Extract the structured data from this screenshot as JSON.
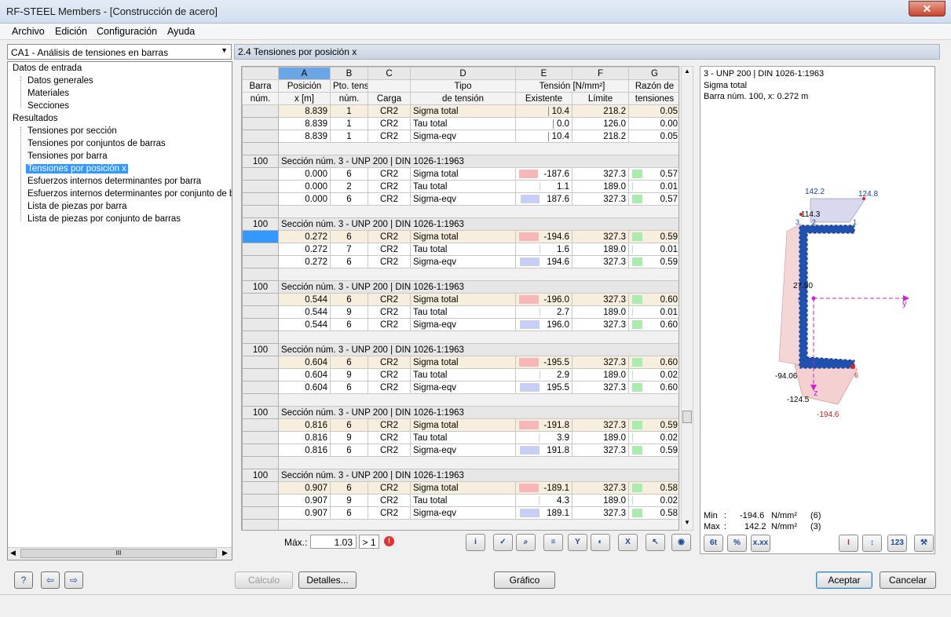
{
  "window": {
    "title": "RF-STEEL Members - [Construcción de acero]",
    "close_glyph": "✕"
  },
  "menu": [
    "Archivo",
    "Edición",
    "Configuración",
    "Ayuda"
  ],
  "case_select": {
    "value": "CA1 - Análisis de tensiones en barras"
  },
  "tree": {
    "group1": "Datos de entrada",
    "input_items": [
      "Datos generales",
      "Materiales",
      "Secciones"
    ],
    "group2": "Resultados",
    "result_items": [
      "Tensiones por sección",
      "Tensiones por conjuntos de barras",
      "Tensiones por barra",
      "Tensiones por posición x",
      "Esfuerzos internos determinantes por barra",
      "Esfuerzos internos determinantes por conjunto de barra",
      "Lista de piezas por barra",
      "Lista de piezas por conjunto de barras"
    ],
    "selected": "Tensiones por posición x",
    "scroll_thumb": "III"
  },
  "panel_title": "2.4 Tensiones por posición x",
  "table": {
    "col_letters": [
      "A",
      "B",
      "C",
      "D",
      "E",
      "F",
      "G"
    ],
    "header1": [
      "Barra",
      "Posición",
      "Pto. tens.",
      "",
      "Tipo",
      "Tensión [N/mm²]",
      "Razón de"
    ],
    "header2": [
      "núm.",
      "x [m]",
      "núm.",
      "Carga",
      "de tensión",
      "Existente",
      "Límite",
      "tensiones"
    ],
    "top_rows": [
      {
        "x": "8.839",
        "pt": "1",
        "load": "CR2",
        "type": "Sigma total",
        "exist": "10.4",
        "limit": "218.2",
        "ratio": "0.05",
        "hl": true
      },
      {
        "x": "8.839",
        "pt": "1",
        "load": "CR2",
        "type": "Tau total",
        "exist": "0.0",
        "limit": "126.0",
        "ratio": "0.00",
        "hl": false
      },
      {
        "x": "8.839",
        "pt": "1",
        "load": "CR2",
        "type": "Sigma-eqv",
        "exist": "10.4",
        "limit": "218.2",
        "ratio": "0.05",
        "hl": false
      }
    ],
    "section_label": "Sección núm.  3 - UNP 200 | DIN 1026-1:1963",
    "groups": [
      {
        "member": "100",
        "rows": [
          {
            "x": "0.000",
            "pt": "6",
            "load": "CR2",
            "type": "Sigma total",
            "exist": "-187.6",
            "limit": "327.3",
            "ratio": "0.57"
          },
          {
            "x": "0.000",
            "pt": "2",
            "load": "CR2",
            "type": "Tau total",
            "exist": "1.1",
            "limit": "189.0",
            "ratio": "0.01"
          },
          {
            "x": "0.000",
            "pt": "6",
            "load": "CR2",
            "type": "Sigma-eqv",
            "exist": "187.6",
            "limit": "327.3",
            "ratio": "0.57"
          }
        ]
      },
      {
        "member": "100",
        "rows": [
          {
            "x": "0.272",
            "pt": "6",
            "load": "CR2",
            "type": "Sigma total",
            "exist": "-194.6",
            "limit": "327.3",
            "ratio": "0.59"
          },
          {
            "x": "0.272",
            "pt": "7",
            "load": "CR2",
            "type": "Tau total",
            "exist": "1.6",
            "limit": "189.0",
            "ratio": "0.01"
          },
          {
            "x": "0.272",
            "pt": "6",
            "load": "CR2",
            "type": "Sigma-eqv",
            "exist": "194.6",
            "limit": "327.3",
            "ratio": "0.59"
          }
        ]
      },
      {
        "member": "100",
        "rows": [
          {
            "x": "0.544",
            "pt": "6",
            "load": "CR2",
            "type": "Sigma total",
            "exist": "-196.0",
            "limit": "327.3",
            "ratio": "0.60"
          },
          {
            "x": "0.544",
            "pt": "9",
            "load": "CR2",
            "type": "Tau total",
            "exist": "2.7",
            "limit": "189.0",
            "ratio": "0.01"
          },
          {
            "x": "0.544",
            "pt": "6",
            "load": "CR2",
            "type": "Sigma-eqv",
            "exist": "196.0",
            "limit": "327.3",
            "ratio": "0.60"
          }
        ]
      },
      {
        "member": "100",
        "rows": [
          {
            "x": "0.604",
            "pt": "6",
            "load": "CR2",
            "type": "Sigma total",
            "exist": "-195.5",
            "limit": "327.3",
            "ratio": "0.60"
          },
          {
            "x": "0.604",
            "pt": "9",
            "load": "CR2",
            "type": "Tau total",
            "exist": "2.9",
            "limit": "189.0",
            "ratio": "0.02"
          },
          {
            "x": "0.604",
            "pt": "6",
            "load": "CR2",
            "type": "Sigma-eqv",
            "exist": "195.5",
            "limit": "327.3",
            "ratio": "0.60"
          }
        ]
      },
      {
        "member": "100",
        "rows": [
          {
            "x": "0.816",
            "pt": "6",
            "load": "CR2",
            "type": "Sigma total",
            "exist": "-191.8",
            "limit": "327.3",
            "ratio": "0.59"
          },
          {
            "x": "0.816",
            "pt": "9",
            "load": "CR2",
            "type": "Tau total",
            "exist": "3.9",
            "limit": "189.0",
            "ratio": "0.02"
          },
          {
            "x": "0.816",
            "pt": "6",
            "load": "CR2",
            "type": "Sigma-eqv",
            "exist": "191.8",
            "limit": "327.3",
            "ratio": "0.59"
          }
        ]
      },
      {
        "member": "100",
        "rows": [
          {
            "x": "0.907",
            "pt": "6",
            "load": "CR2",
            "type": "Sigma total",
            "exist": "-189.1",
            "limit": "327.3",
            "ratio": "0.58"
          },
          {
            "x": "0.907",
            "pt": "9",
            "load": "CR2",
            "type": "Tau total",
            "exist": "4.3",
            "limit": "189.0",
            "ratio": "0.02"
          },
          {
            "x": "0.907",
            "pt": "6",
            "load": "CR2",
            "type": "Sigma-eqv",
            "exist": "189.1",
            "limit": "327.3",
            "ratio": "0.58"
          }
        ]
      }
    ],
    "highlight_row_index": 0,
    "selected_group": 1
  },
  "max": {
    "label": "Máx.:",
    "value": "1.03",
    "cmp": "> 1",
    "warn_glyph": "!"
  },
  "table_tools": [
    "info-icon",
    "check-icon",
    "zoom-icon",
    "sort-icon",
    "filter-icon",
    "color-icon",
    "excel-icon",
    "pointer-icon",
    "eye-icon"
  ],
  "graphic": {
    "line1": "3 - UNP 200 | DIN 1026-1:1963",
    "line2": "Sigma total",
    "line3": "Barra núm. 100, x: 0.272 m",
    "labels": {
      "a": "142.2",
      "b": "124.8",
      "c": "114.3",
      "d": "27.90",
      "e": "-94.06",
      "f": "-124.5",
      "g": "-194.6",
      "y": "y",
      "z": "z",
      "p1": "1",
      "p2": "2",
      "p3": "3",
      "p5": "5",
      "p6": "6"
    },
    "min_label": "Min",
    "min_value": "-194.6",
    "min_unit": "N/mm²",
    "min_point": "(6)",
    "max_label": "Max",
    "max_value": "142.2",
    "max_unit": "N/mm²",
    "max_point": "(3)",
    "tool_texts": [
      "6t",
      "%",
      "x.xx",
      "",
      "",
      "123",
      ""
    ]
  },
  "buttons": {
    "calc": "Cálculo",
    "details": "Detalles...",
    "graphic": "Gráfico",
    "ok": "Aceptar",
    "cancel": "Cancelar"
  }
}
